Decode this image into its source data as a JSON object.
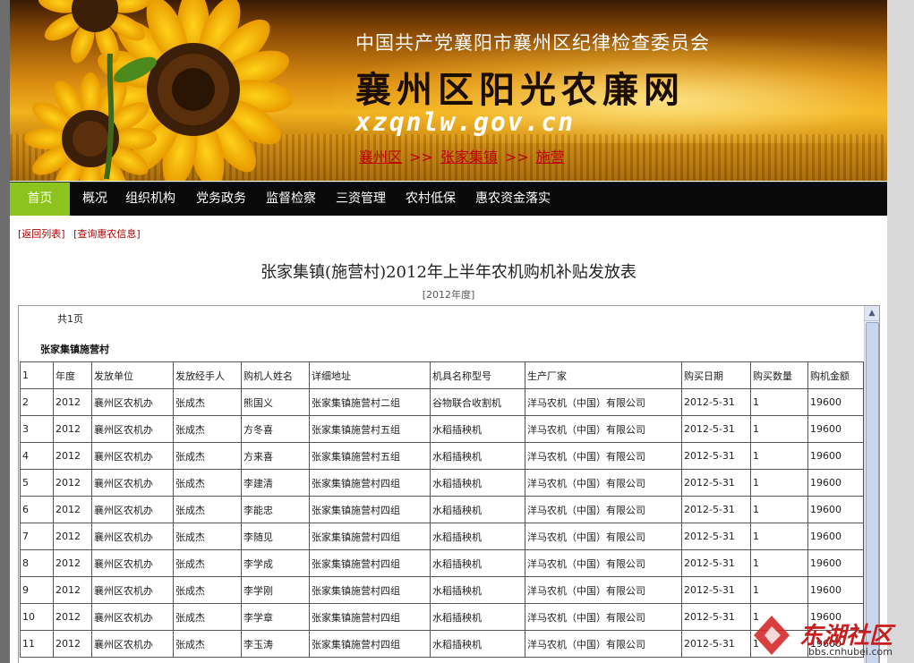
{
  "banner": {
    "org": "中国共产党襄阳市襄州区纪律检查委员会",
    "site_title": "襄州区阳光农廉网",
    "domain": "xzqnlw.gov.cn",
    "breadcrumb": [
      "襄州区",
      "张家集镇",
      "施营"
    ],
    "breadcrumb_sep": ">>"
  },
  "nav": {
    "items": [
      "首页",
      "概况",
      "组织机构",
      "党务政务",
      "监督检察",
      "三资管理",
      "农村低保",
      "惠农资金落实"
    ],
    "active_color": "#8cc31c"
  },
  "links": [
    "[返回列表]",
    "[查询惠农信息]"
  ],
  "doc": {
    "title": "张家集镇(施营村)2012年上半年农机购机补贴发放表",
    "year": "[2012年度]",
    "pages": "共1页",
    "village": "张家集镇施营村"
  },
  "table": {
    "rows": [
      [
        "1",
        "年度",
        "发放单位",
        "发放经手人",
        "购机人姓名",
        "详细地址",
        "机具名称型号",
        "生产厂家",
        "购买日期",
        "购买数量",
        "购机金额"
      ],
      [
        "2",
        "2012",
        "襄州区农机办",
        "张成杰",
        "熊国义",
        "张家集镇施营村二组",
        "谷物联合收割机",
        "洋马农机（中国）有限公司",
        "2012-5-31",
        "1",
        "19600"
      ],
      [
        "3",
        "2012",
        "襄州区农机办",
        "张成杰",
        "方冬喜",
        "张家集镇施营村五组",
        "水稻插秧机",
        "洋马农机（中国）有限公司",
        "2012-5-31",
        "1",
        "19600"
      ],
      [
        "4",
        "2012",
        "襄州区农机办",
        "张成杰",
        "方来喜",
        "张家集镇施营村五组",
        "水稻插秧机",
        "洋马农机（中国）有限公司",
        "2012-5-31",
        "1",
        "19600"
      ],
      [
        "5",
        "2012",
        "襄州区农机办",
        "张成杰",
        "李建清",
        "张家集镇施营村四组",
        "水稻插秧机",
        "洋马农机（中国）有限公司",
        "2012-5-31",
        "1",
        "19600"
      ],
      [
        "6",
        "2012",
        "襄州区农机办",
        "张成杰",
        "李能忠",
        "张家集镇施营村四组",
        "水稻插秧机",
        "洋马农机（中国）有限公司",
        "2012-5-31",
        "1",
        "19600"
      ],
      [
        "7",
        "2012",
        "襄州区农机办",
        "张成杰",
        "李随见",
        "张家集镇施营村四组",
        "水稻插秧机",
        "洋马农机（中国）有限公司",
        "2012-5-31",
        "1",
        "19600"
      ],
      [
        "8",
        "2012",
        "襄州区农机办",
        "张成杰",
        "李学成",
        "张家集镇施营村四组",
        "水稻插秧机",
        "洋马农机（中国）有限公司",
        "2012-5-31",
        "1",
        "19600"
      ],
      [
        "9",
        "2012",
        "襄州区农机办",
        "张成杰",
        "李学刚",
        "张家集镇施营村四组",
        "水稻插秧机",
        "洋马农机（中国）有限公司",
        "2012-5-31",
        "1",
        "19600"
      ],
      [
        "10",
        "2012",
        "襄州区农机办",
        "张成杰",
        "李学章",
        "张家集镇施营村四组",
        "水稻插秧机",
        "洋马农机（中国）有限公司",
        "2012-5-31",
        "1",
        "19600"
      ],
      [
        "11",
        "2012",
        "襄州区农机办",
        "张成杰",
        "李玉涛",
        "张家集镇施营村四组",
        "水稻插秧机",
        "洋马农机（中国）有限公司",
        "2012-5-31",
        "1",
        "19600"
      ]
    ]
  },
  "watermark": {
    "text": "东湖社区",
    "url": "bbs.cnhubei.com"
  }
}
